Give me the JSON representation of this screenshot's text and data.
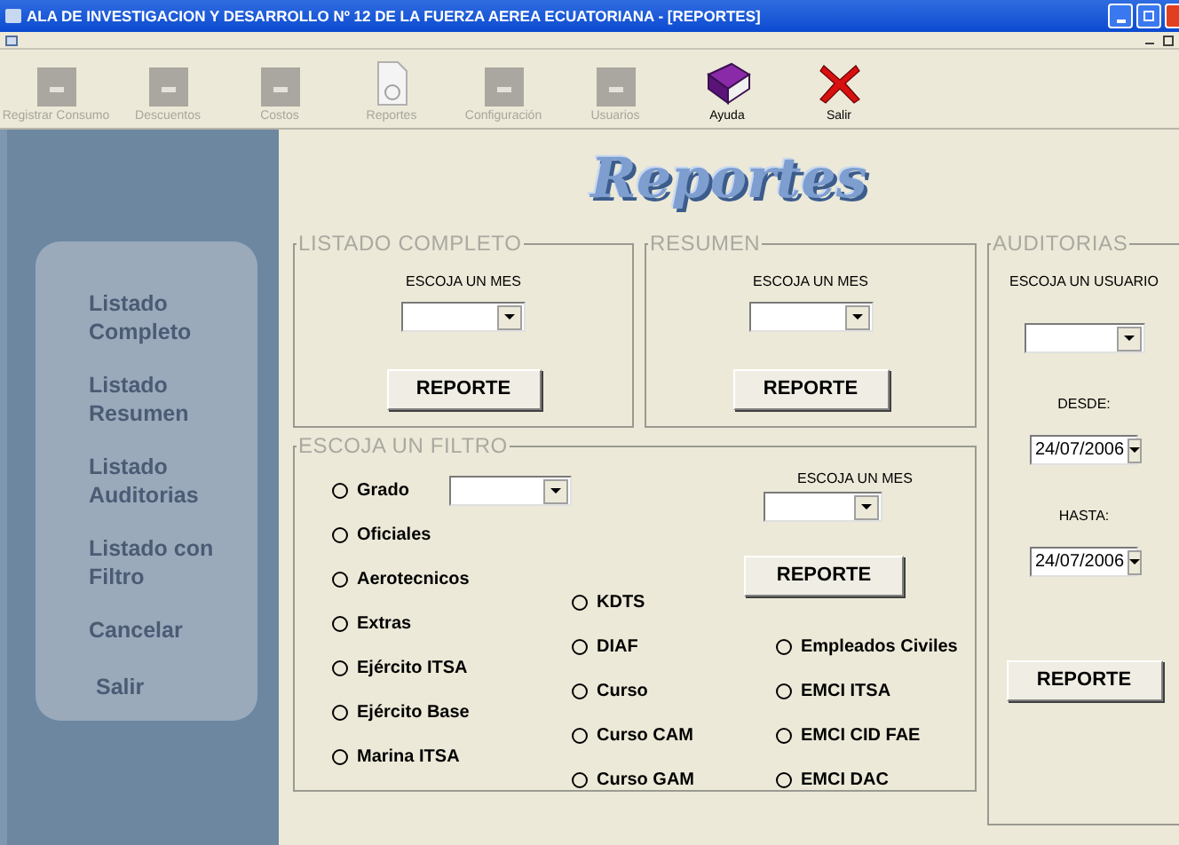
{
  "window": {
    "title": "ALA DE INVESTIGACION Y DESARROLLO Nº 12 DE LA FUERZA AEREA ECUATORIANA - [REPORTES]"
  },
  "toolbar": [
    {
      "label": "Registrar Consumo",
      "disabled": true
    },
    {
      "label": "Descuentos",
      "disabled": true
    },
    {
      "label": "Costos",
      "disabled": true
    },
    {
      "label": "Reportes",
      "disabled": true
    },
    {
      "label": "Configuración",
      "disabled": true
    },
    {
      "label": "Usuarios",
      "disabled": true
    },
    {
      "label": "Ayuda",
      "disabled": false
    },
    {
      "label": "Salir",
      "disabled": false
    }
  ],
  "sidebar": {
    "items": [
      "Listado Completo",
      "Listado Resumen",
      "Listado Auditorias",
      "Listado con Filtro",
      "Cancelar",
      "Salir"
    ]
  },
  "heading": "Reportes",
  "listado_completo": {
    "title": "LISTADO COMPLETO",
    "month_label": "ESCOJA UN MES",
    "button": "REPORTE"
  },
  "resumen": {
    "title": "RESUMEN",
    "month_label": "ESCOJA UN MES",
    "button": "REPORTE"
  },
  "auditorias": {
    "title": "AUDITORIAS",
    "user_label": "ESCOJA UN USUARIO",
    "from_label": "DESDE:",
    "from_value": "24/07/2006",
    "to_label": "HASTA:",
    "to_value": "24/07/2006",
    "button": "REPORTE"
  },
  "filtro": {
    "title": "ESCOJA UN FILTRO",
    "grado": {
      "label": "Grado",
      "selected": false
    },
    "month_label": "ESCOJA UN MES",
    "button": "REPORTE",
    "columns": [
      [
        {
          "label": "Oficiales",
          "selected": false
        },
        {
          "label": "Aerotecnicos",
          "selected": false
        },
        {
          "label": "Extras",
          "selected": false
        },
        {
          "label": "Ejército ITSA",
          "selected": false
        },
        {
          "label": "Ejército Base",
          "selected": false
        },
        {
          "label": "Marina ITSA",
          "selected": false
        }
      ],
      [
        {
          "label": "KDTS",
          "selected": false
        },
        {
          "label": "DIAF",
          "selected": false
        },
        {
          "label": "Curso",
          "selected": false
        },
        {
          "label": "Curso CAM",
          "selected": false
        },
        {
          "label": "Curso GAM",
          "selected": false
        }
      ],
      [
        {
          "label": "Empleados Civiles",
          "selected": false
        },
        {
          "label": "EMCI ITSA",
          "selected": false
        },
        {
          "label": "EMCI CID FAE",
          "selected": false
        },
        {
          "label": "EMCI DAC",
          "selected": false
        }
      ]
    ]
  }
}
